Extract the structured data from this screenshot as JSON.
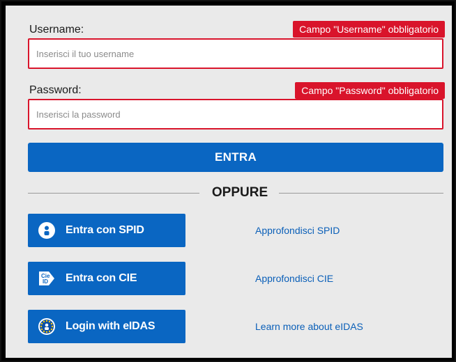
{
  "login": {
    "username": {
      "label": "Username:",
      "error": "Campo \"Username\" obbligatorio",
      "placeholder": "Inserisci il tuo username",
      "value": ""
    },
    "password": {
      "label": "Password:",
      "error": "Campo \"Password\" obbligatorio",
      "placeholder": "Inserisci la password",
      "value": ""
    },
    "submit_label": "ENTRA",
    "divider_text": "OPPURE"
  },
  "providers": [
    {
      "label": "Entra con SPID",
      "icon": "spid-user-icon",
      "link": "Approfondisci SPID"
    },
    {
      "label": "Entra con CIE",
      "icon": "cie-id-icon",
      "link": "Approfondisci CIE"
    },
    {
      "label": "Login with eIDAS",
      "icon": "eidas-stars-icon",
      "link": "Learn more about eIDAS"
    }
  ],
  "cie_icon_text": "Cie ID",
  "colors": {
    "primary": "#0a66c2",
    "error": "#d9142b",
    "background": "#eaeaea",
    "link": "#0a5fb8"
  }
}
